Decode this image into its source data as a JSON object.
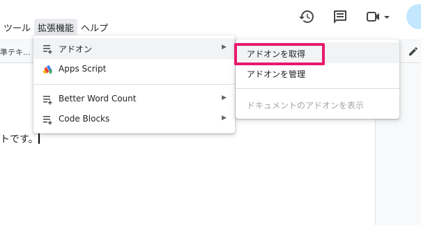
{
  "menubar": {
    "tools": "ツール",
    "extensions": "拡張機能",
    "help": "ヘルプ"
  },
  "header_icons": [
    "history-icon",
    "comment-icon",
    "meet-icon",
    "dropdown-caret-icon"
  ],
  "toolbar": {
    "style_label": "準テキ..."
  },
  "document": {
    "text": "トです。"
  },
  "extensions_menu": {
    "items": [
      {
        "label": "アドオン",
        "icon": "addons-icon",
        "has_submenu": true
      },
      {
        "label": "Apps Script",
        "icon": "apps-script-icon",
        "has_submenu": false
      },
      {
        "label": "Better Word Count",
        "icon": "addons-icon",
        "has_submenu": true
      },
      {
        "label": "Code Blocks",
        "icon": "addons-icon",
        "has_submenu": true
      }
    ]
  },
  "addons_submenu": {
    "items": [
      {
        "label": "アドオンを取得",
        "state": "highlighted"
      },
      {
        "label": "アドオンを管理",
        "state": "normal"
      },
      {
        "label": "ドキュメントのアドオンを表示",
        "state": "disabled"
      }
    ]
  },
  "colors": {
    "highlight_border": "#e8196c",
    "menu_hover": "#f1f3f4",
    "active_menu_bg": "#e8eaed",
    "avatar_bg": "#c2e7ff"
  }
}
